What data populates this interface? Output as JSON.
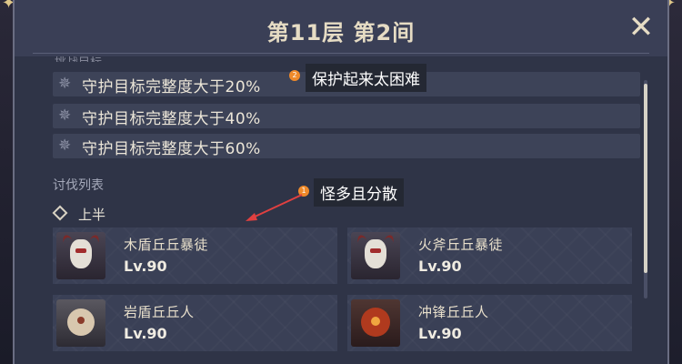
{
  "header": {
    "title": "第11层 第2间",
    "close_icon": "close-icon"
  },
  "goals": {
    "cut_label": "挑战目标",
    "items": [
      {
        "text": "守护目标完整度大于20%",
        "icon": "gear-star-icon"
      },
      {
        "text": "守护目标完整度大于40%",
        "icon": "gear-star-icon"
      },
      {
        "text": "守护目标完整度大于60%",
        "icon": "gear-star-icon"
      }
    ]
  },
  "enemies": {
    "section_title": "讨伐列表",
    "half_label": "上半",
    "cards": [
      {
        "name": "木盾丘丘暴徒",
        "level": "Lv.90",
        "portrait": "mitachurl-wood"
      },
      {
        "name": "火斧丘丘暴徒",
        "level": "Lv.90",
        "portrait": "mitachurl-fire"
      },
      {
        "name": "岩盾丘丘人",
        "level": "Lv.90",
        "portrait": "hilichurl-rock"
      },
      {
        "name": "冲锋丘丘人",
        "level": "Lv.90",
        "portrait": "hilichurl-berserker"
      }
    ]
  },
  "annotations": [
    {
      "badge": "2",
      "text": "保护起来太困难"
    },
    {
      "badge": "1",
      "text": "怪多且分散"
    }
  ],
  "colors": {
    "accent": "#e6dcc4",
    "badge": "#f08a2a",
    "panel": "#2f3447"
  }
}
